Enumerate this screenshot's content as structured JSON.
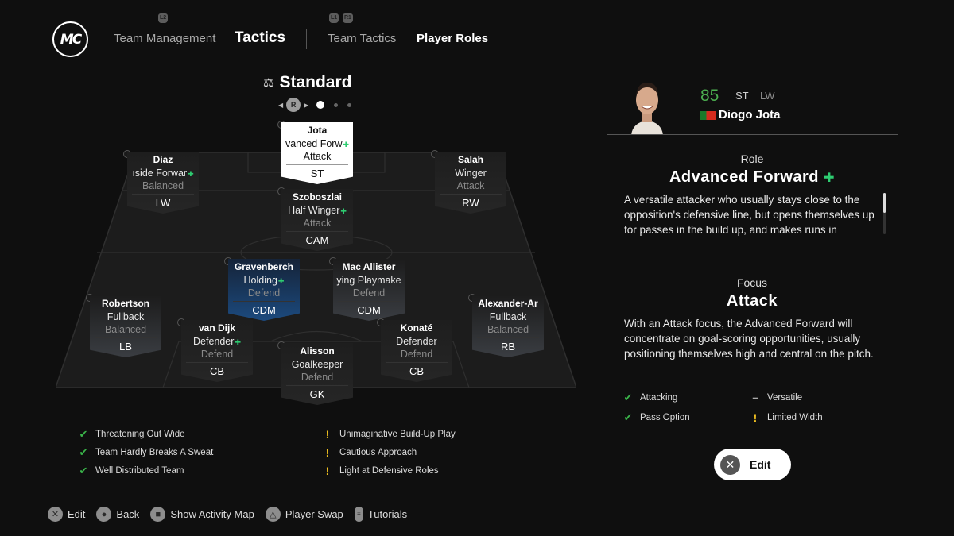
{
  "nav": {
    "logo": "MC",
    "team_management": "Team Management",
    "tactics": "Tactics",
    "team_tactics": "Team Tactics",
    "player_roles": "Player Roles",
    "hint_l2": "L2",
    "hint_l1": "L1",
    "hint_r1": "R1"
  },
  "formation": {
    "name": "Standard",
    "icon": "scale-icon",
    "pager_button": "R",
    "pages": 3,
    "current_page": 1
  },
  "players": [
    {
      "id": "st",
      "name": "Jota",
      "role": "vanced Forw",
      "role_plus": true,
      "focus": "Attack",
      "position": "ST",
      "state": "selected"
    },
    {
      "id": "lw",
      "name": "Díaz",
      "role": "ıside Forwar",
      "role_plus": true,
      "focus": "Balanced",
      "position": "LW",
      "state": "normal"
    },
    {
      "id": "rw",
      "name": "Salah",
      "role": "Winger",
      "role_plus": false,
      "focus": "Attack",
      "position": "RW",
      "state": "normal"
    },
    {
      "id": "cam",
      "name": "Szoboszlai",
      "role": "Half Winger",
      "role_plus": true,
      "focus": "Attack",
      "position": "CAM",
      "state": "normal"
    },
    {
      "id": "cdm1",
      "name": "Gravenberch",
      "role": "Holding",
      "role_plus": true,
      "focus": "Defend",
      "position": "CDM",
      "state": "highlight"
    },
    {
      "id": "cdm2",
      "name": "Mac Allister",
      "role": "ying Playmake",
      "role_plus": false,
      "focus": "Defend",
      "position": "CDM",
      "state": "fade"
    },
    {
      "id": "lb",
      "name": "Robertson",
      "role": "Fullback",
      "role_plus": false,
      "focus": "Balanced",
      "position": "LB",
      "state": "fade"
    },
    {
      "id": "rb",
      "name": "Alexander-Ar",
      "role": "Fullback",
      "role_plus": false,
      "focus": "Balanced",
      "position": "RB",
      "state": "fade"
    },
    {
      "id": "cb1",
      "name": "van Dijk",
      "role": "Defender",
      "role_plus": true,
      "focus": "Defend",
      "position": "CB",
      "state": "normal"
    },
    {
      "id": "cb2",
      "name": "Konaté",
      "role": "Defender",
      "role_plus": false,
      "focus": "Defend",
      "position": "CB",
      "state": "normal"
    },
    {
      "id": "gk",
      "name": "Alisson",
      "role": "Goalkeeper",
      "role_plus": false,
      "focus": "Defend",
      "position": "GK",
      "state": "normal"
    }
  ],
  "strengths": [
    "Threatening Out Wide",
    "Team Hardly Breaks A Sweat",
    "Well Distributed Team"
  ],
  "weaknesses": [
    "Unimaginative Build-Up Play",
    "Cautious Approach",
    "Light at Defensive Roles"
  ],
  "footer": [
    {
      "icon": "cross-button-icon",
      "glyph": "✕",
      "label": "Edit"
    },
    {
      "icon": "circle-button-icon",
      "glyph": "●",
      "label": "Back"
    },
    {
      "icon": "square-button-icon",
      "glyph": "■",
      "label": "Show Activity Map"
    },
    {
      "icon": "triangle-button-icon",
      "glyph": "△",
      "label": "Player Swap"
    },
    {
      "icon": "touchpad-button-icon",
      "glyph": "≡",
      "label": "Tutorials"
    }
  ],
  "selected_player": {
    "rating": "85",
    "position": "ST",
    "alt_position": "LW",
    "nationality": "Portugal",
    "name": "Diogo Jota",
    "role_label": "Role",
    "role": "Advanced Forward",
    "role_plus": "✚",
    "role_description": "A versatile attacker who usually stays close to the opposition's defensive line, but opens themselves up for passes in the build up, and makes runs in",
    "focus_label": "Focus",
    "focus": "Attack",
    "focus_description": "With an Attack focus, the Advanced Forward will concentrate on goal-scoring opportunities, usually positioning themselves high and central on the pitch.",
    "traits": [
      {
        "type": "positive",
        "label": "Attacking"
      },
      {
        "type": "neutral",
        "label": "Versatile"
      },
      {
        "type": "positive",
        "label": "Pass Option"
      },
      {
        "type": "warning",
        "label": "Limited Width"
      }
    ],
    "edit_label": "Edit"
  },
  "colors": {
    "background": "#0f0f0f",
    "positive": "#3ab54a",
    "warning": "#f0c020",
    "rating": "#4caf50",
    "highlight_card": "#1c4a7e"
  }
}
